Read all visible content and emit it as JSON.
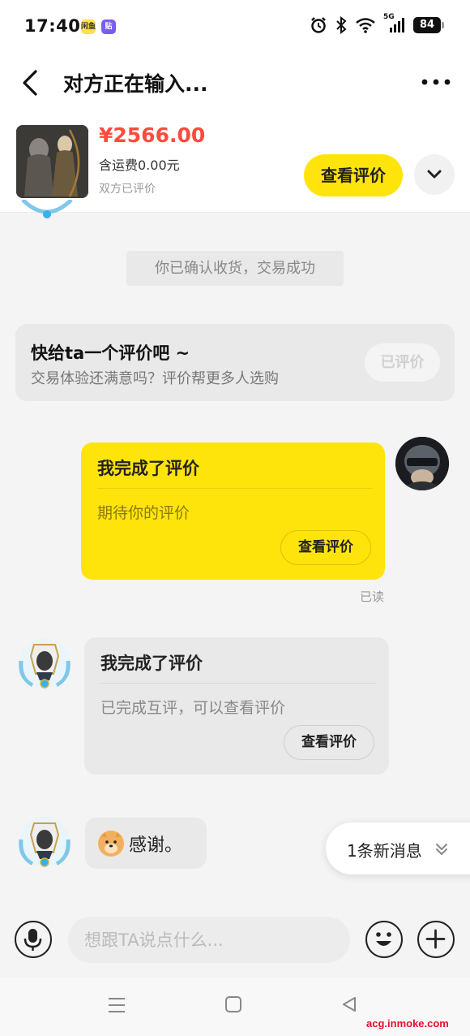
{
  "status_bar": {
    "time": "17:40",
    "app_badge_1": "闲鱼",
    "app_badge_2": "贴",
    "network": "5G",
    "battery": "84"
  },
  "nav": {
    "title": "对方正在输入..."
  },
  "product": {
    "price": "¥2566.00",
    "shipping": "含运费0.00元",
    "review_status": "双方已评价",
    "view_review_label": "查看评价"
  },
  "chat": {
    "system_message": "你已确认收货，交易成功",
    "review_prompt": {
      "title": "快给ta一个评价吧 ~",
      "description": "交易体验还满意吗？评价帮更多人选购",
      "button_label": "已评价"
    },
    "my_review_card": {
      "title": "我完成了评价",
      "description": "期待你的评价",
      "button_label": "查看评价",
      "read_status": "已读"
    },
    "other_review_card": {
      "title": "我完成了评价",
      "description": "已完成互评，可以查看评价",
      "button_label": "查看评价"
    },
    "thanks_message": "感谢。",
    "new_message_notice": "1条新消息"
  },
  "input": {
    "placeholder": "想跟TA说点什么..."
  },
  "watermark": "acg.inmoke.com",
  "colors": {
    "accent_yellow": "#ffe40c",
    "price_red": "#ff4a3d",
    "watermark_red": "#e8102a"
  }
}
